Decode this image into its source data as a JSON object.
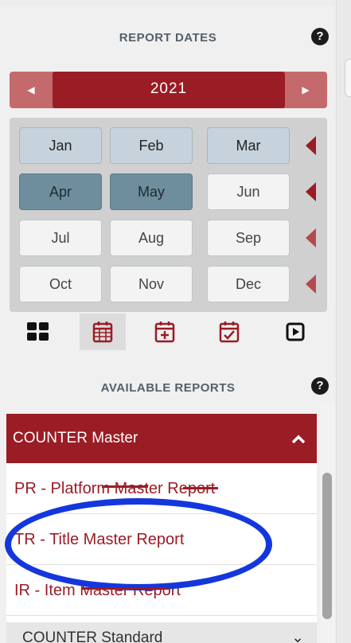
{
  "report_dates": {
    "title": "REPORT DATES",
    "help": "?",
    "year": "2021",
    "prev_arrow": "◀",
    "next_arrow": "▶",
    "months": [
      {
        "label": "Jan",
        "state": "light"
      },
      {
        "label": "Feb",
        "state": "light"
      },
      {
        "label": "Mar",
        "state": "light"
      },
      {
        "label": "Apr",
        "state": "dark"
      },
      {
        "label": "May",
        "state": "dark"
      },
      {
        "label": "Jun",
        "state": "plain"
      },
      {
        "label": "Jul",
        "state": "plain"
      },
      {
        "label": "Aug",
        "state": "plain"
      },
      {
        "label": "Sep",
        "state": "plain"
      },
      {
        "label": "Oct",
        "state": "plain"
      },
      {
        "label": "Nov",
        "state": "plain"
      },
      {
        "label": "Dec",
        "state": "plain"
      }
    ],
    "toolbar_icons": [
      "grid-view-icon",
      "calendar-icon",
      "calendar-plus-icon",
      "calendar-check-icon",
      "play-square-icon"
    ],
    "active_tool": "calendar-icon"
  },
  "available_reports": {
    "title": "AVAILABLE REPORTS",
    "help": "?",
    "group_title": "COUNTER Master",
    "group_chevron": "^",
    "items": [
      "PR - Platform Master Report",
      "TR - Title Master Report",
      "IR - Item Master Report"
    ],
    "next_group_title": "COUNTER Standard",
    "next_group_chevron": "⌄"
  },
  "colors": {
    "brand_red": "#9a1c25",
    "annotation_blue": "#1437dd",
    "month_light": "#c7d3dc",
    "month_dark": "#6e8e9e"
  }
}
